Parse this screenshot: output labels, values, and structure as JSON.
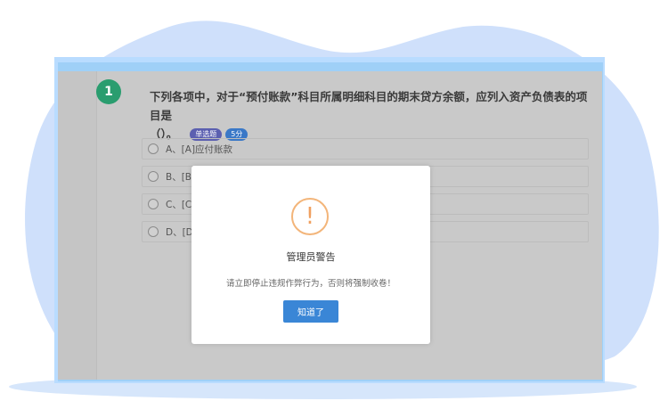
{
  "question": {
    "number": "1",
    "text_line1": "下列各项中，对于“预付账款”科目所属明细科目的期末贷方余额，应列入资产负债表的项目是",
    "text_line2": "（）。",
    "type_badge": "单选题",
    "score_badge": "5分"
  },
  "options": [
    {
      "label": "A、[A]应付账款"
    },
    {
      "label": "B、[B]"
    },
    {
      "label": "C、[C]"
    },
    {
      "label": "D、[D]"
    }
  ],
  "modal": {
    "icon": "!",
    "title": "管理员警告",
    "message": "请立即停止违规作弊行为，否则将强制收卷！",
    "button_label": "知道了"
  },
  "colors": {
    "question_number_bg": "#2a9d6f",
    "type_badge_bg": "#5b5fb0",
    "score_badge_bg": "#3a78c7",
    "warning_icon": "#f0a060",
    "button_bg": "#3a86d6",
    "overlay": "#c5c5c5"
  }
}
